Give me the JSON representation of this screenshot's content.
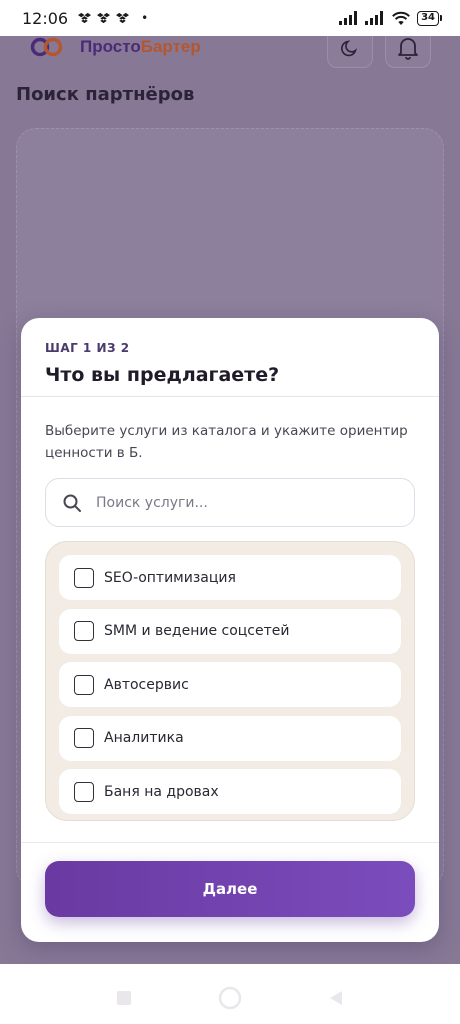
{
  "status_bar": {
    "time": "12:06",
    "dot": "•",
    "battery": "34"
  },
  "app": {
    "brand_part1": "Просто",
    "brand_part2": "Бартер",
    "page_title": "Поиск партнёров",
    "colors": {
      "brand_purple": "#4b2a78",
      "brand_orange": "#b5562f"
    }
  },
  "modal": {
    "step": "ШАГ 1 ИЗ 2",
    "title": "Что вы предлагаете?",
    "description": "Выберите услуги из каталога и укажите ориентир ценности в Б.",
    "search_placeholder": "Поиск услуги...",
    "services": [
      {
        "label": "SEO-оптимизация",
        "checked": false
      },
      {
        "label": "SMM и ведение соцсетей",
        "checked": false
      },
      {
        "label": "Автосервис",
        "checked": false
      },
      {
        "label": "Аналитика",
        "checked": false
      },
      {
        "label": "Баня на дровах",
        "checked": false
      }
    ],
    "next_label": "Далее",
    "colors": {
      "accent": "#6a3aa2",
      "list_bg": "#f3ece4"
    }
  },
  "icons": {
    "notifications": [
      "dropbox-icon",
      "dropbox-icon",
      "dropbox-icon"
    ],
    "status_right": [
      "signal-icon",
      "signal-icon",
      "wifi-icon",
      "battery-icon"
    ],
    "header": [
      "moon-icon",
      "bell-icon"
    ],
    "search": "search-icon",
    "nav": [
      "recent-apps-icon",
      "home-icon",
      "back-icon"
    ]
  }
}
